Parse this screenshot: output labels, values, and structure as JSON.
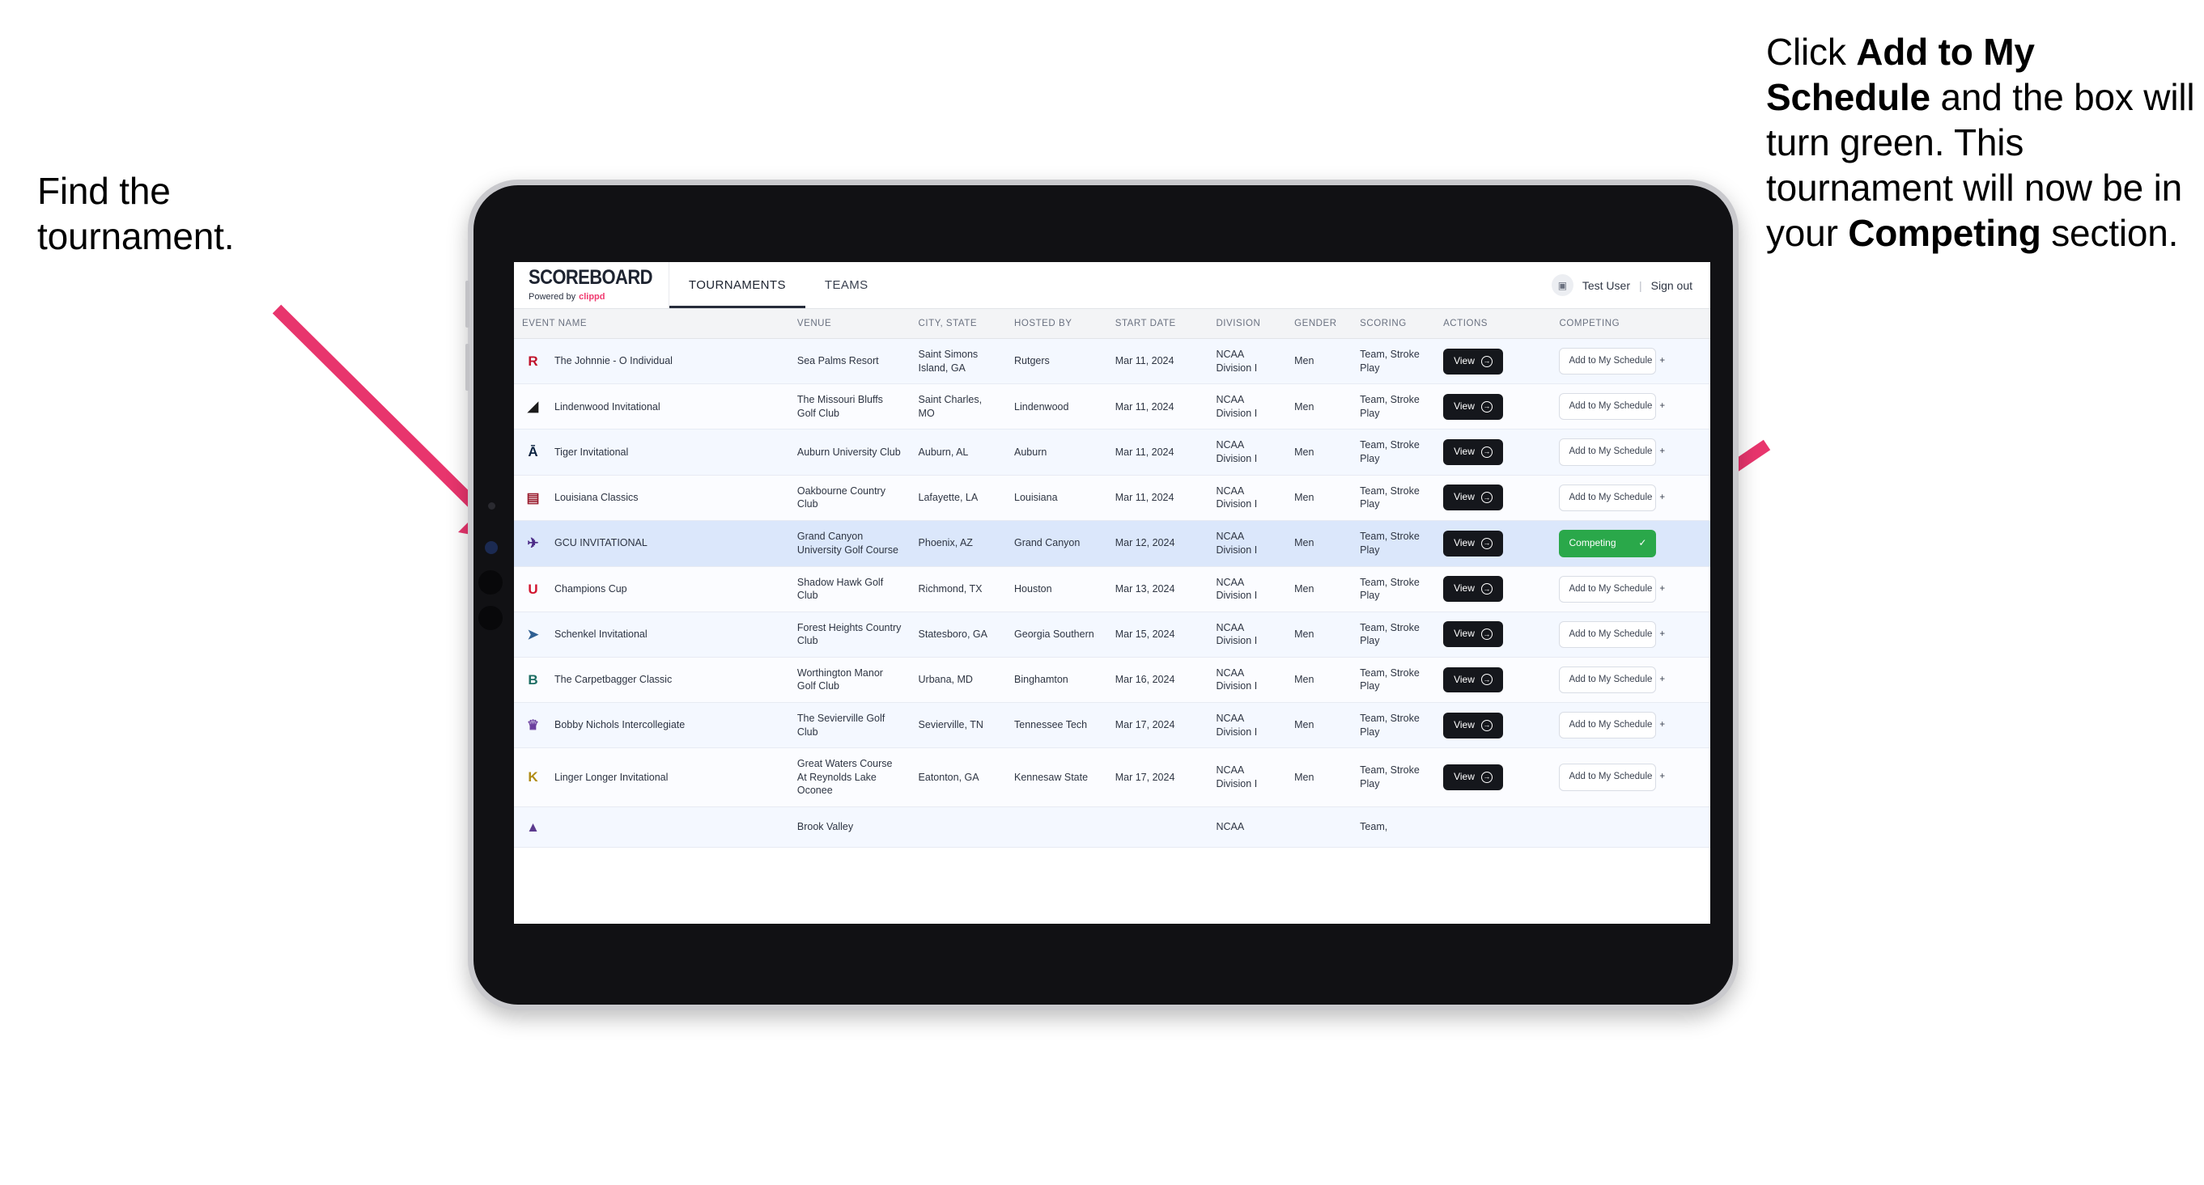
{
  "annotations": {
    "left": {
      "line1": "Find the",
      "line2": "tournament."
    },
    "right": {
      "part1": "Click ",
      "bold1": "Add to My Schedule",
      "part2": " and the box will turn green. This tournament will now be in your ",
      "bold2": "Competing",
      "part3": " section."
    },
    "arrow_color": "#e8356d"
  },
  "app": {
    "brand": {
      "title": "SCOREBOARD",
      "powered_prefix": "Powered by",
      "powered_brand": "clippd"
    },
    "tabs": [
      {
        "label": "TOURNAMENTS",
        "active": true
      },
      {
        "label": "TEAMS",
        "active": false
      }
    ],
    "user": {
      "avatar_icon": "user-avatar-icon",
      "name": "Test User",
      "separator": "|",
      "sign_out": "Sign out"
    }
  },
  "table": {
    "columns": [
      "EVENT NAME",
      "VENUE",
      "CITY, STATE",
      "HOSTED BY",
      "START DATE",
      "DIVISION",
      "GENDER",
      "SCORING",
      "ACTIONS",
      "COMPETING"
    ],
    "action_label": "View",
    "action_icon": "arrow-circle-right-icon",
    "add_label": "Add to My Schedule",
    "add_icon": "plus-icon",
    "competing_label": "Competing",
    "competing_icon": "check-icon",
    "competing_color": "#2aa84a",
    "rows": [
      {
        "logo": "R",
        "logo_color": "#c0132b",
        "logo_bg": "transparent",
        "event": "The Johnnie - O Individual",
        "venue": "Sea Palms Resort",
        "city": "Saint Simons Island, GA",
        "host": "Rutgers",
        "date": "Mar 11, 2024",
        "division": "NCAA Division I",
        "gender": "Men",
        "scoring": "Team, Stroke Play",
        "competing": false
      },
      {
        "logo": "◢",
        "logo_color": "#1b1b1b",
        "logo_bg": "transparent",
        "event": "Lindenwood Invitational",
        "venue": "The Missouri Bluffs Golf Club",
        "city": "Saint Charles, MO",
        "host": "Lindenwood",
        "date": "Mar 11, 2024",
        "division": "NCAA Division I",
        "gender": "Men",
        "scoring": "Team, Stroke Play",
        "competing": false
      },
      {
        "logo": "Ā",
        "logo_color": "#0b2341",
        "logo_bg": "transparent",
        "event": "Tiger Invitational",
        "venue": "Auburn University Club",
        "city": "Auburn, AL",
        "host": "Auburn",
        "date": "Mar 11, 2024",
        "division": "NCAA Division I",
        "gender": "Men",
        "scoring": "Team, Stroke Play",
        "competing": false
      },
      {
        "logo": "▤",
        "logo_color": "#9a1c2e",
        "logo_bg": "transparent",
        "event": "Louisiana Classics",
        "venue": "Oakbourne Country Club",
        "city": "Lafayette, LA",
        "host": "Louisiana",
        "date": "Mar 11, 2024",
        "division": "NCAA Division I",
        "gender": "Men",
        "scoring": "Team, Stroke Play",
        "competing": false
      },
      {
        "logo": "✈",
        "logo_color": "#4b2a86",
        "logo_bg": "transparent",
        "event": "GCU INVITATIONAL",
        "venue": "Grand Canyon University Golf Course",
        "city": "Phoenix, AZ",
        "host": "Grand Canyon",
        "date": "Mar 12, 2024",
        "division": "NCAA Division I",
        "gender": "Men",
        "scoring": "Team, Stroke Play",
        "competing": true,
        "selected": true
      },
      {
        "logo": "U",
        "logo_color": "#d2152f",
        "logo_bg": "transparent",
        "event": "Champions Cup",
        "venue": "Shadow Hawk Golf Club",
        "city": "Richmond, TX",
        "host": "Houston",
        "date": "Mar 13, 2024",
        "division": "NCAA Division I",
        "gender": "Men",
        "scoring": "Team, Stroke Play",
        "competing": false
      },
      {
        "logo": "➤",
        "logo_color": "#2f5f92",
        "logo_bg": "transparent",
        "event": "Schenkel Invitational",
        "venue": "Forest Heights Country Club",
        "city": "Statesboro, GA",
        "host": "Georgia Southern",
        "date": "Mar 15, 2024",
        "division": "NCAA Division I",
        "gender": "Men",
        "scoring": "Team, Stroke Play",
        "competing": false
      },
      {
        "logo": "B",
        "logo_color": "#1c6d63",
        "logo_bg": "transparent",
        "event": "The Carpetbagger Classic",
        "venue": "Worthington Manor Golf Club",
        "city": "Urbana, MD",
        "host": "Binghamton",
        "date": "Mar 16, 2024",
        "division": "NCAA Division I",
        "gender": "Men",
        "scoring": "Team, Stroke Play",
        "competing": false
      },
      {
        "logo": "♛",
        "logo_color": "#6b3f9e",
        "logo_bg": "transparent",
        "event": "Bobby Nichols Intercollegiate",
        "venue": "The Sevierville Golf Club",
        "city": "Sevierville, TN",
        "host": "Tennessee Tech",
        "date": "Mar 17, 2024",
        "division": "NCAA Division I",
        "gender": "Men",
        "scoring": "Team, Stroke Play",
        "competing": false
      },
      {
        "logo": "K",
        "logo_color": "#b08b14",
        "logo_bg": "transparent",
        "event": "Linger Longer Invitational",
        "venue": "Great Waters Course At Reynolds Lake Oconee",
        "city": "Eatonton, GA",
        "host": "Kennesaw State",
        "date": "Mar 17, 2024",
        "division": "NCAA Division I",
        "gender": "Men",
        "scoring": "Team, Stroke Play",
        "competing": false
      },
      {
        "logo": "▲",
        "logo_color": "#5b3a8e",
        "logo_bg": "transparent",
        "event": "",
        "venue": "Brook Valley",
        "city": "",
        "host": "",
        "date": "",
        "division": "NCAA",
        "gender": "",
        "scoring": "Team,",
        "competing": false,
        "cut_off": true
      }
    ]
  }
}
